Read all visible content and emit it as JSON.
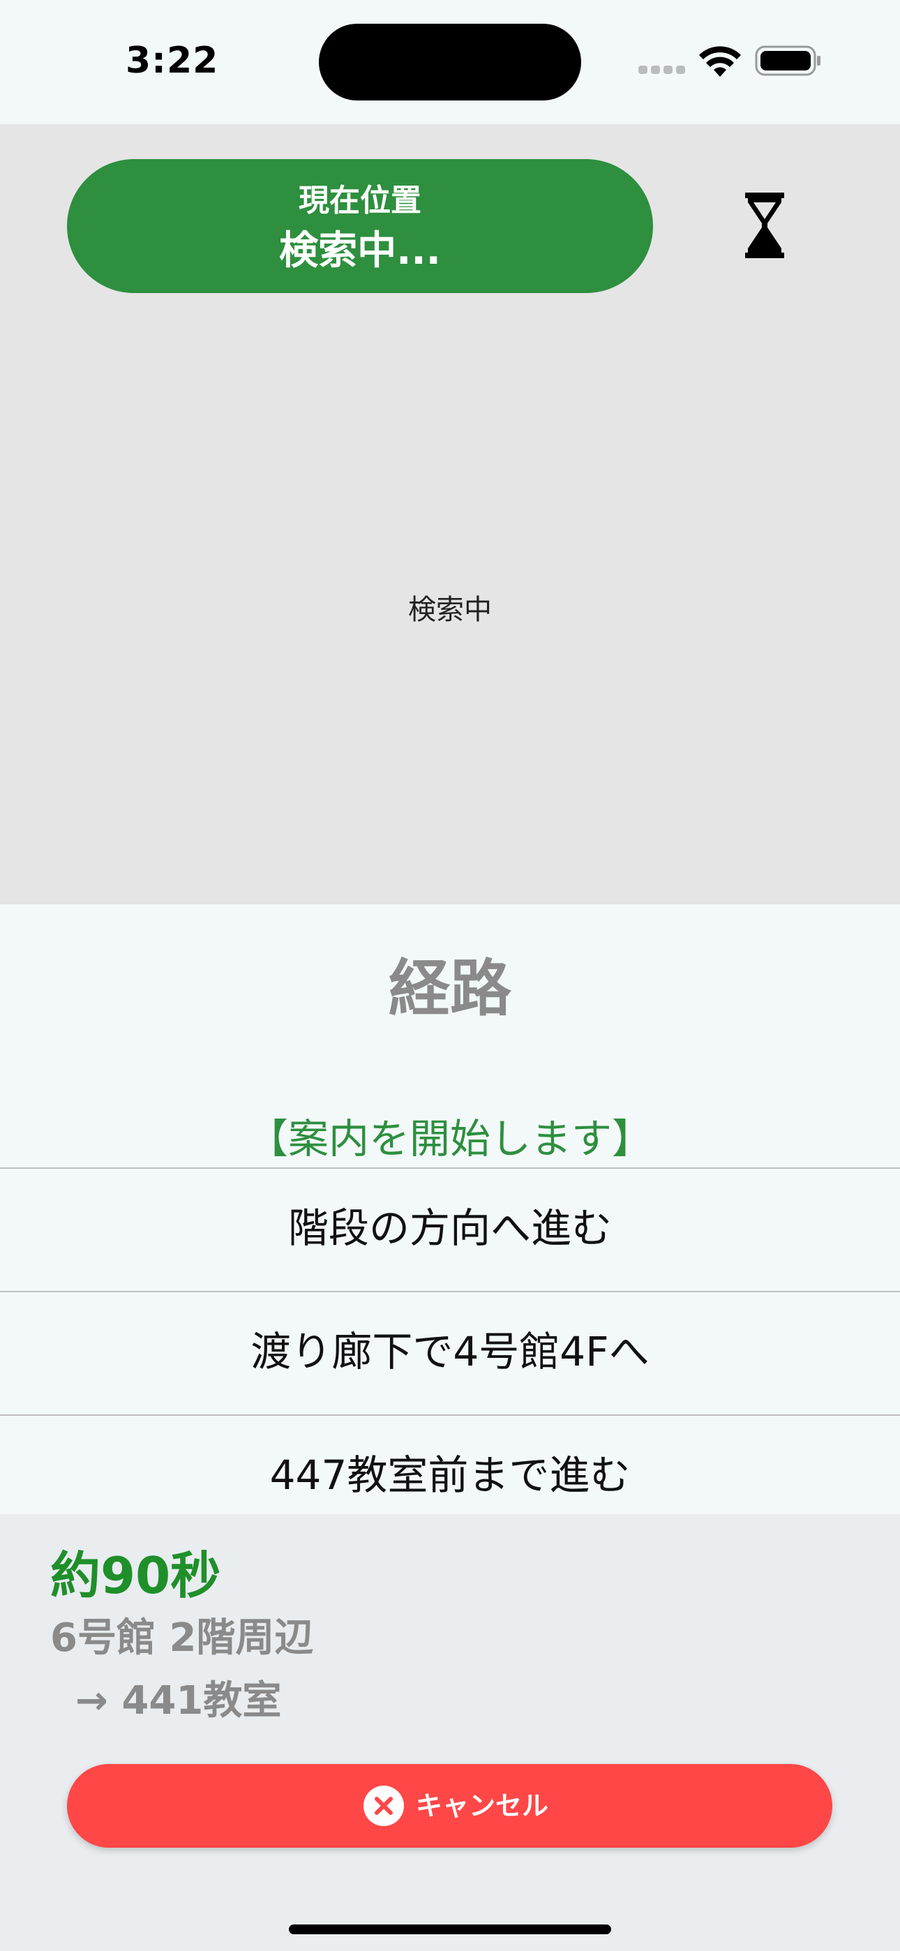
{
  "status_bar": {
    "time": "3:22"
  },
  "location": {
    "title": "現在位置",
    "value": "検索中..."
  },
  "map": {
    "status_text": "検索中"
  },
  "route": {
    "title": "経路",
    "steps": [
      "【案内を開始します】",
      "階段の方向へ進む",
      "渡り廊下で4号館4Fへ",
      "447教室前まで進む"
    ]
  },
  "summary": {
    "eta": "約90秒",
    "origin": "6号館 2階周辺",
    "destination": "→ 441教室"
  },
  "actions": {
    "cancel_label": "キャンセル"
  },
  "icons": {
    "status_loading": "hourglass-icon",
    "cancel": "x-circle-icon",
    "wifi": "wifi-icon",
    "battery": "battery-icon",
    "signal": "cellular-signal-icon"
  },
  "colors": {
    "accent_green": "#2e8f3f",
    "eta_green": "#1f8f2a",
    "cancel_red": "#ff4747",
    "muted_gray": "#8a8a8a"
  }
}
